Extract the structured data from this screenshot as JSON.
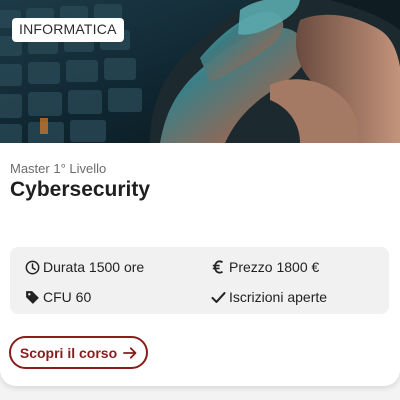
{
  "card": {
    "category_badge": "INFORMATICA",
    "level": "Master 1° Livello",
    "title": "Cybersecurity",
    "info": {
      "duration": "Durata 1500 ore",
      "price": "Prezzo 1800 €",
      "cfu": "CFU 60",
      "enrollment": "Iscrizioni aperte"
    },
    "cta_label": "Scopri il corso"
  },
  "colors": {
    "accent": "#8a1c1c",
    "info_background": "#f1f1f2",
    "title": "#1f1f1f"
  },
  "icons": {
    "duration": "clock-icon",
    "price": "euro-icon",
    "cfu": "tag-icon",
    "enrollment": "check-icon",
    "cta": "arrow-right-icon"
  }
}
